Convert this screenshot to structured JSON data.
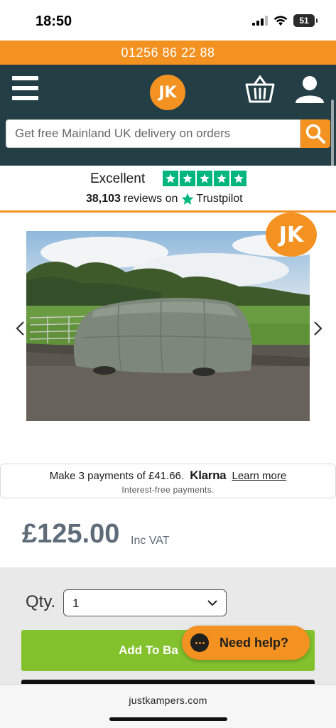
{
  "status_bar": {
    "time": "18:50",
    "battery": "51"
  },
  "top_bar": {
    "phone": "01256 86 22 88"
  },
  "header": {
    "logo_text": "JK",
    "search": {
      "placeholder": "Get free Mainland UK delivery on orders"
    }
  },
  "trustpilot": {
    "rating_word": "Excellent",
    "review_count": "38,103",
    "reviews_on": "reviews on",
    "brand": "Trustpilot",
    "stars": 5
  },
  "gallery": {
    "badge_text": "JK"
  },
  "klarna": {
    "prefix": "Make 3 payments of £41.66.",
    "brand": "Klarna",
    "link": "Learn more",
    "subtext": "Interest-free payments."
  },
  "product": {
    "price": "£125.00",
    "vat_label": "Inc VAT"
  },
  "cart": {
    "qty_label": "Qty.",
    "qty_value": "1",
    "add_button": "Add To Ba"
  },
  "chat": {
    "label": "Need help?"
  },
  "browser": {
    "url": "justkampers.com"
  },
  "colors": {
    "orange": "#f39121",
    "header_teal": "#233e45",
    "green": "#83c12d",
    "trustpilot_green": "#00b67a",
    "price_grey": "#5e6b78"
  }
}
